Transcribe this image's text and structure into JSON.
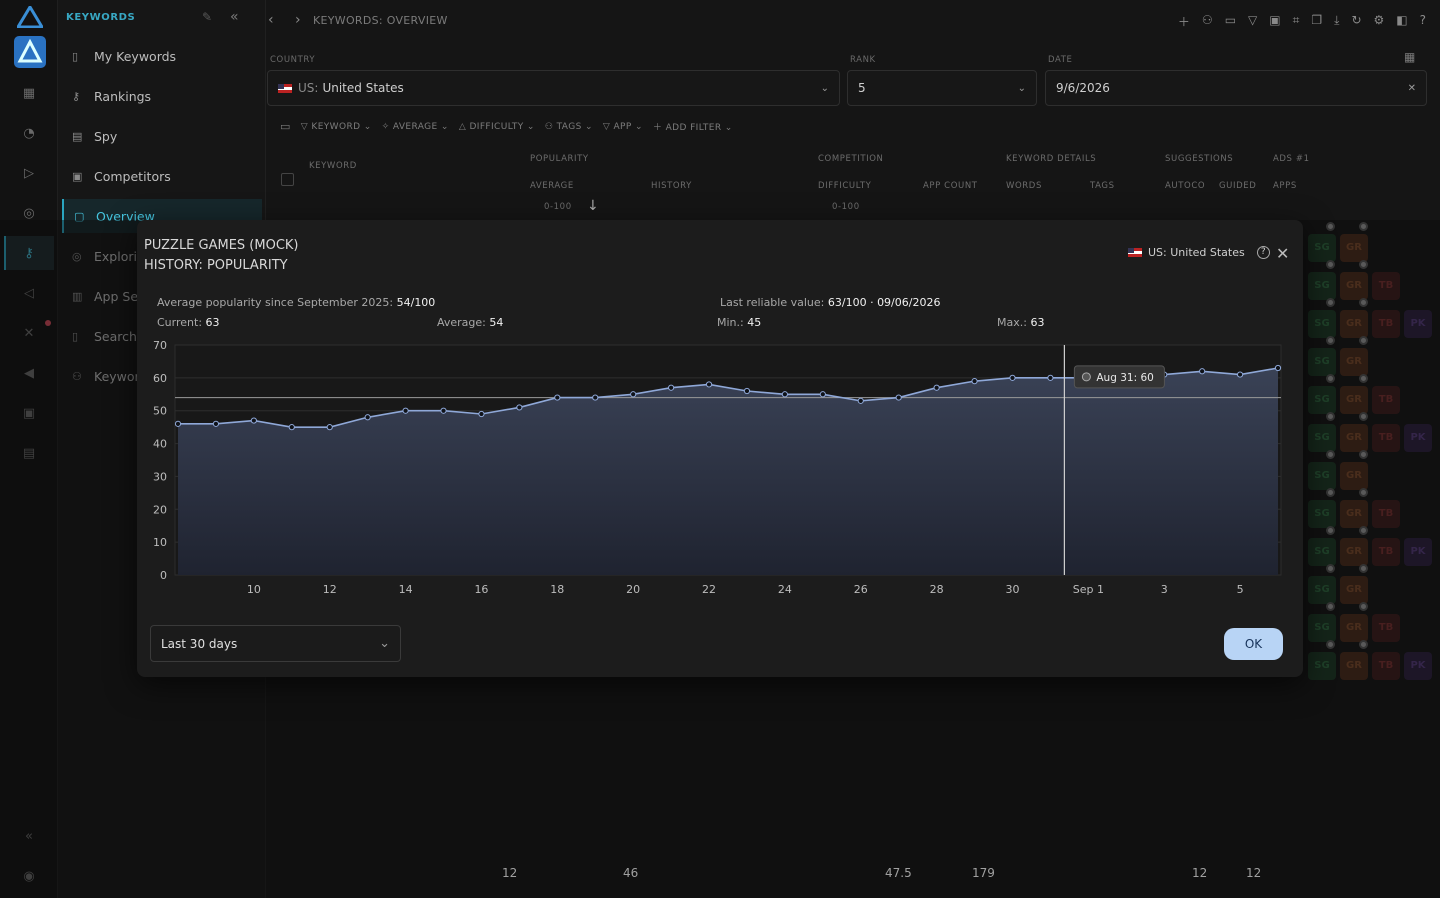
{
  "nav": {
    "section_title": "KEYWORDS",
    "items": [
      {
        "label": "My Keywords",
        "icon": "bookmark-icon"
      },
      {
        "label": "Rankings",
        "icon": "key-icon"
      },
      {
        "label": "Spy",
        "icon": "spy-icon"
      },
      {
        "label": "Competitors",
        "icon": "competitors-icon"
      },
      {
        "label": "Overview",
        "icon": "overview-icon",
        "active": true
      },
      {
        "label": "Exploring",
        "icon": "explore-icon"
      },
      {
        "label": "App Sea",
        "icon": "bar-chart-icon"
      },
      {
        "label": "Search T",
        "icon": "document-icon"
      },
      {
        "label": "Keyword",
        "icon": "group-icon"
      }
    ]
  },
  "header": {
    "breadcrumb": "KEYWORDS: OVERVIEW"
  },
  "filters": {
    "country_label": "COUNTRY",
    "country_prefix": "US:",
    "country_value": "United States",
    "rank_label": "RANK",
    "rank_value": "5",
    "date_label": "DATE",
    "date_value": "9/6/2026",
    "chips": [
      "KEYWORD",
      "AVERAGE",
      "DIFFICULTY",
      "TAGS",
      "APP",
      "ADD FILTER"
    ]
  },
  "table": {
    "keyword_header": "KEYWORD",
    "groups": [
      "POPULARITY",
      "COMPETITION",
      "KEYWORD DETAILS",
      "SUGGESTIONS",
      "ADS #1"
    ],
    "subheaders": [
      "AVERAGE",
      "HISTORY",
      "DIFFICULTY",
      "APP COUNT",
      "WORDS",
      "TAGS",
      "AUTOCO",
      "GUIDED",
      "APPS"
    ],
    "range_hint": "0-100",
    "range_hint2": "0-100",
    "totals": [
      "12",
      "46",
      "47.5",
      "179",
      "12",
      "12"
    ]
  },
  "modal": {
    "title_line1": "PUZZLE GAMES (MOCK)",
    "title_line2": "HISTORY: POPULARITY",
    "region": "US: United States",
    "stats": {
      "avg_since_label": "Average popularity since September 2025:",
      "avg_since_value": "54/100",
      "last_reliable_label": "Last reliable value:",
      "last_reliable_value": "63/100 · 09/06/2026",
      "current_label": "Current:",
      "current_value": "63",
      "average_label": "Average:",
      "average_value": "54",
      "min_label": "Min.:",
      "min_value": "45",
      "max_label": "Max.:",
      "max_value": "63"
    },
    "tooltip": "Aug 31: 60",
    "range_select": "Last 30 days",
    "ok_label": "OK"
  },
  "chart_data": {
    "type": "area",
    "x": [
      "Aug 8",
      "Aug 9",
      "Aug 10",
      "Aug 11",
      "Aug 12",
      "Aug 13",
      "Aug 14",
      "Aug 15",
      "Aug 16",
      "Aug 17",
      "Aug 18",
      "Aug 19",
      "Aug 20",
      "Aug 21",
      "Aug 22",
      "Aug 23",
      "Aug 24",
      "Aug 25",
      "Aug 26",
      "Aug 27",
      "Aug 28",
      "Aug 29",
      "Aug 30",
      "Aug 31",
      "Sep 1",
      "Sep 2",
      "Sep 3",
      "Sep 4",
      "Sep 5",
      "Sep 6"
    ],
    "values": [
      46,
      46,
      47,
      45,
      45,
      48,
      50,
      50,
      49,
      51,
      54,
      54,
      55,
      57,
      58,
      56,
      55,
      55,
      53,
      54,
      57,
      59,
      60,
      60,
      60,
      60,
      61,
      62,
      61,
      63
    ],
    "x_tick_labels": [
      "10",
      "12",
      "14",
      "16",
      "18",
      "20",
      "22",
      "24",
      "26",
      "28",
      "30",
      "Sep 1",
      "3",
      "5"
    ],
    "ylim": [
      0,
      70
    ],
    "y_ticks": [
      0,
      10,
      20,
      30,
      40,
      50,
      60,
      70
    ],
    "average_line": 54,
    "highlight_index": 23,
    "colors": {
      "line": "#8fa8d8",
      "fill": "#2a3142",
      "avg": "#9a9a9a",
      "cursor": "#d0d0d0"
    },
    "grid": true
  }
}
